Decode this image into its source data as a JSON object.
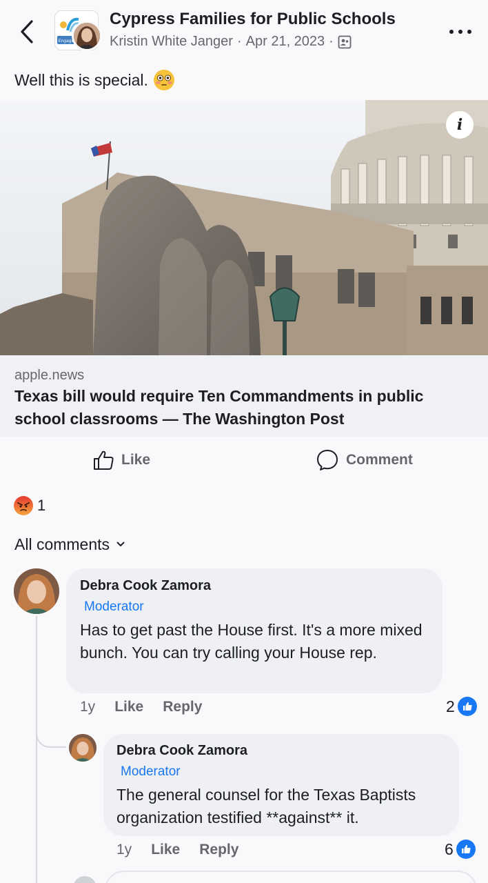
{
  "header": {
    "group_name": "Cypress Families for Public Schools",
    "author": "Kristin White Janger",
    "date": "Apr 21, 2023",
    "separator": "·",
    "group_logo_text": "Engage"
  },
  "post": {
    "text": "Well this is special."
  },
  "link": {
    "domain": "apple.news",
    "title": "Texas bill would require Ten Commandments in public school classrooms — The Washington Post"
  },
  "actions": {
    "like_label": "Like",
    "comment_label": "Comment"
  },
  "reactions": {
    "count": "1"
  },
  "comments_filter": {
    "label": "All comments"
  },
  "comments": [
    {
      "author": "Debra Cook Zamora",
      "badge": "Moderator",
      "text": "Has to get past the House first.  It's a more mixed bunch.  You can try calling your House rep.",
      "age": "1y",
      "like_label": "Like",
      "reply_label": "Reply",
      "like_count": "2"
    },
    {
      "author": "Debra Cook Zamora",
      "badge": "Moderator",
      "text": "The general counsel for the Texas Baptists organization testified **against** it.",
      "age": "1y",
      "like_label": "Like",
      "reply_label": "Reply",
      "like_count": "6"
    }
  ],
  "colors": {
    "accent": "#1877f2",
    "muted_text": "#65676b",
    "bubble": "#eef0f3"
  }
}
